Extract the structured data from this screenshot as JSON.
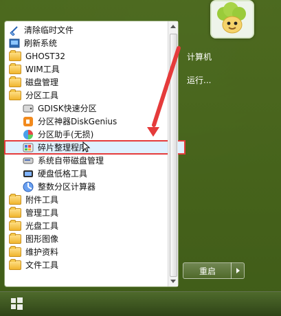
{
  "start_menu": {
    "left_items": [
      {
        "label": "清除临时文件",
        "icon": "broom-icon"
      },
      {
        "label": "刷新系统",
        "icon": "refresh-icon"
      },
      {
        "label": "GHOST32",
        "icon": "folder-icon"
      },
      {
        "label": "WIM工具",
        "icon": "folder-icon"
      },
      {
        "label": "磁盘管理",
        "icon": "folder-icon"
      },
      {
        "label": "分区工具",
        "icon": "folder-icon"
      },
      {
        "label": "GDISK快速分区",
        "icon": "disk-icon"
      },
      {
        "label": "分区神器DiskGenius",
        "icon": "diskgenius-icon"
      },
      {
        "label": "分区助手(无损)",
        "icon": "partition-assistant-icon"
      },
      {
        "label": "碎片整理程序",
        "icon": "defrag-icon"
      },
      {
        "label": "系统自带磁盘管理",
        "icon": "disk-management-icon"
      },
      {
        "label": "硬盘低格工具",
        "icon": "low-format-icon"
      },
      {
        "label": "整数分区计算器",
        "icon": "calculator-icon"
      },
      {
        "label": "附件工具",
        "icon": "folder-icon"
      },
      {
        "label": "管理工具",
        "icon": "folder-icon"
      },
      {
        "label": "光盘工具",
        "icon": "folder-icon"
      },
      {
        "label": "图形图像",
        "icon": "folder-icon"
      },
      {
        "label": "维护资料",
        "icon": "folder-icon"
      },
      {
        "label": "文件工具",
        "icon": "folder-icon"
      }
    ],
    "right_items": [
      {
        "label": "计算机"
      },
      {
        "label": "运行..."
      }
    ],
    "restart_label": "重启"
  },
  "colors": {
    "highlight_border": "#e53b3b",
    "panel_bg": "#ffffff",
    "menu_bg": "#4f6f1f"
  },
  "taskbar": {
    "start_icon": "windows-logo-icon"
  }
}
